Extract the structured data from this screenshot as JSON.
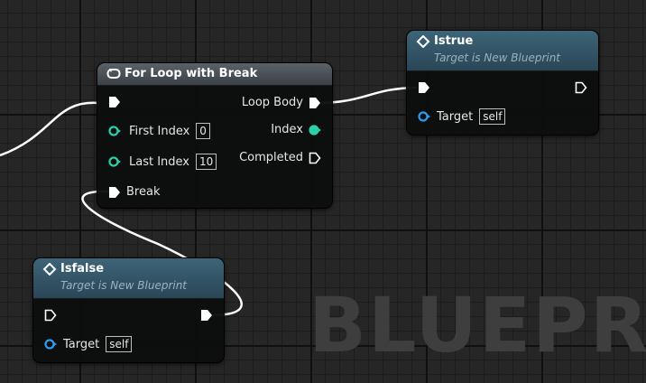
{
  "nodes": {
    "for_loop": {
      "title": "For Loop with Break",
      "pins": {
        "first_index": {
          "label": "First Index",
          "value": "0"
        },
        "last_index": {
          "label": "Last Index",
          "value": "10"
        },
        "break": {
          "label": "Break"
        },
        "loop_body": {
          "label": "Loop Body"
        },
        "index": {
          "label": "Index"
        },
        "completed": {
          "label": "Completed"
        }
      }
    },
    "istrue": {
      "title": "Istrue",
      "subtitle": "Target is New Blueprint",
      "pins": {
        "target": {
          "label": "Target",
          "value": "self"
        }
      }
    },
    "isfalse": {
      "title": "Isfalse",
      "subtitle": "Target is New Blueprint",
      "pins": {
        "target": {
          "label": "Target",
          "value": "self"
        }
      }
    }
  },
  "watermark": "BLUEPRIN",
  "colors": {
    "exec_pin": "#ffffff",
    "int_pin": "#2bd0a8",
    "object_pin": "#2b9cf0",
    "wire": "#ffffff"
  }
}
